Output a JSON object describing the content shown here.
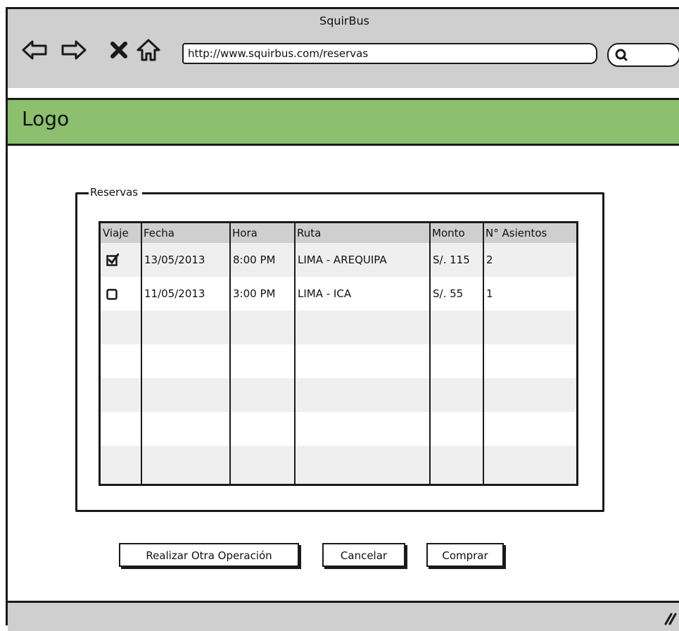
{
  "window": {
    "title": "SquirBus"
  },
  "nav": {
    "url": "http://www.squirbus.com/reservas",
    "icons": [
      "back-arrow-icon",
      "forward-arrow-icon",
      "close-icon",
      "home-icon",
      "search-icon"
    ]
  },
  "header": {
    "logo": "Logo",
    "color": "#8cbf6e"
  },
  "reservas": {
    "legend": "Reservas",
    "columns": [
      "Viaje",
      "Fecha",
      "Hora",
      "Ruta",
      "Monto",
      "N° Asientos"
    ],
    "rows": [
      {
        "viaje": true,
        "fecha": "13/05/2013",
        "hora": "8:00 PM",
        "ruta": "LIMA - AREQUIPA",
        "monto": "S/. 115",
        "asientos": "2"
      },
      {
        "viaje": false,
        "fecha": "11/05/2013",
        "hora": "3:00 PM",
        "ruta": "LIMA - ICA",
        "monto": "S/. 55",
        "asientos": "1"
      }
    ]
  },
  "actions": {
    "otra_operacion": "Realizar Otra Operación",
    "cancelar": "Cancelar",
    "comprar": "Comprar"
  }
}
